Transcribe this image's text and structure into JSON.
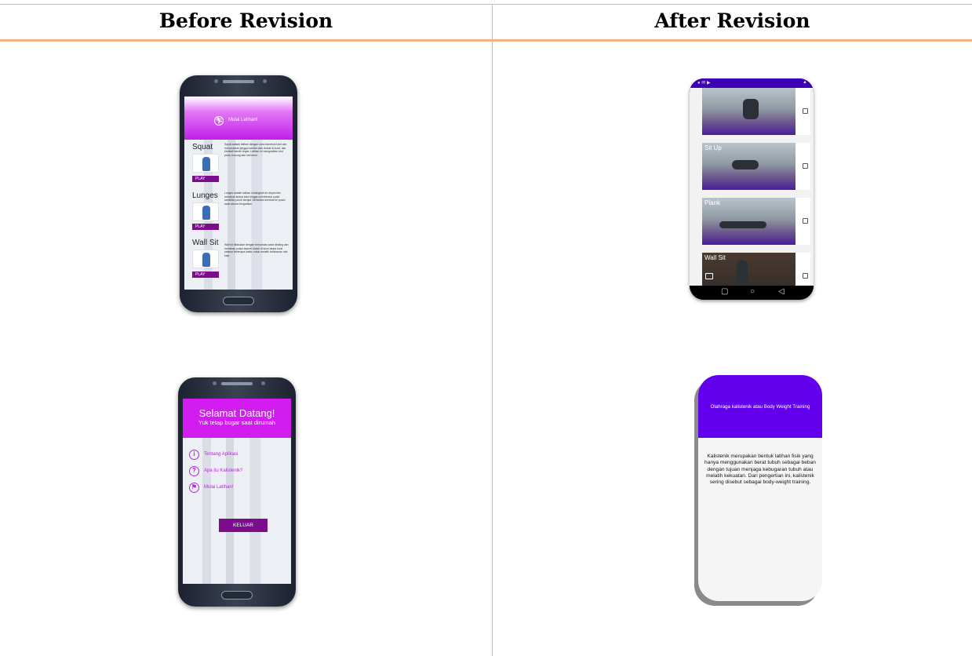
{
  "table": {
    "col_before": "Before Revision",
    "col_after": "After Revision"
  },
  "before": {
    "exercise_screen": {
      "header_title": "Mulai Latihan!",
      "exercises": [
        {
          "name": "Squat",
          "play": "PLAY",
          "desc": "Squat adalah latihan dengan cara menekuk lutut dan menurunkan pinggul seolah-olah duduk di kursi, lalu kembali berdiri tegak. Latihan ini menguatkan otot paha, bokong dan inti tubuh."
        },
        {
          "name": "Lunges",
          "play": "PLAY",
          "desc": "Lunges adalah latihan melangkah ke depan lalu menekuk kedua lutut hingga membentuk sudut sembilan puluh derajat, kemudian kembali ke posisi awal secara bergantian."
        },
        {
          "name": "Wall Sit",
          "play": "PLAY",
          "desc": "Wall sit dilakukan dengan bersandar pada dinding dan menahan posisi seperti duduk di kursi tanpa kursi selama beberapa waktu untuk melatih ketahanan otot kaki."
        }
      ]
    },
    "home_screen": {
      "title": "Selamat Datang!",
      "subtitle": "Yuk tetap bugar saat dirumah",
      "menu": [
        {
          "icon": "i",
          "label": "Tentang Aplikasi"
        },
        {
          "icon": "?",
          "label": "Apa itu Kalistenik?"
        },
        {
          "icon": "⚑",
          "label": "Mulai Latihan!"
        }
      ],
      "exit_button": "KELUAR"
    }
  },
  "after": {
    "video_screen": {
      "items": [
        {
          "label": ""
        },
        {
          "label": "Sit Up"
        },
        {
          "label": "Plank"
        },
        {
          "label": "Wall Sit"
        }
      ]
    },
    "info_screen": {
      "header": "Olahraga kalistenik atau Body Weight Training",
      "body": "Kalistenik merupakan bentuk latihan fisik yang hanya  menggunakan berat tubuh sebagai beban dengan tujuan menjaga kebugaran tubuh atau melatih kekuatan. Dari pengertian ini, kalistenik sering disebut sebagai body-weight training."
    }
  },
  "colors": {
    "table_border": "#f4b183",
    "old_purple": "#c11fe8",
    "new_purple": "#6200ee"
  }
}
